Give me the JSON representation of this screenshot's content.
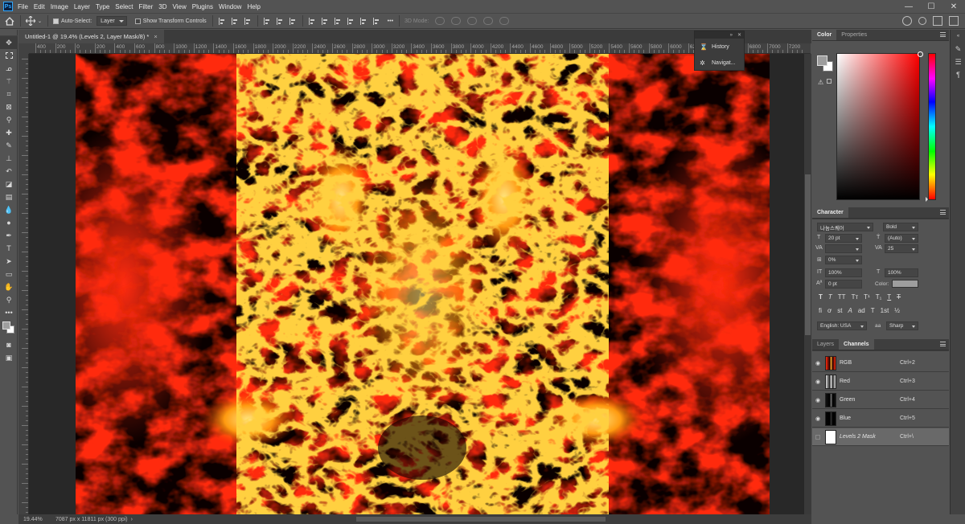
{
  "app": {
    "logo_text": "Ps"
  },
  "menu": [
    "File",
    "Edit",
    "Image",
    "Layer",
    "Type",
    "Select",
    "Filter",
    "3D",
    "View",
    "Plugins",
    "Window",
    "Help"
  ],
  "window_controls": {
    "minimize": "—",
    "maximize": "☐",
    "close": "✕"
  },
  "options_bar": {
    "auto_select_label": "Auto-Select:",
    "auto_select_checked": true,
    "auto_select_target": "Layer",
    "transform_controls_label": "Show Transform Controls",
    "mode_3d_label": "3D Mode:",
    "more_label": "•••"
  },
  "document": {
    "tab_title": "Untitled-1 @ 19.4% (Levels 2, Layer Mask/8) *",
    "tab_close": "×",
    "zoom": "19.44%",
    "doc_info": "7087 px x 11811 px (300 ppi)",
    "status_arrow": "›"
  },
  "ruler": {
    "top_labels": [
      "400",
      "200",
      "0",
      "200",
      "400",
      "600",
      "800",
      "1000",
      "1200",
      "1400",
      "1600",
      "1800",
      "2000",
      "2200",
      "2400",
      "2600",
      "2800",
      "3000",
      "3200",
      "3400",
      "3600",
      "3800",
      "4000",
      "4200",
      "4400",
      "4600",
      "4800",
      "5000",
      "5200",
      "5400",
      "5600",
      "5800",
      "6000",
      "6200",
      "6400",
      "6600",
      "6800",
      "7000",
      "7200"
    ]
  },
  "float_panel": {
    "collapse": "»",
    "close": "✕",
    "items": [
      {
        "label": "History",
        "icon": "history-icon"
      },
      {
        "label": "Navigat...",
        "icon": "navigator-icon"
      }
    ]
  },
  "color_panel": {
    "tabs": [
      "Color",
      "Properties"
    ],
    "foreground": "#9e9e9e",
    "background": "#ffffff",
    "hue": "#ff0000"
  },
  "character_panel": {
    "title": "Character",
    "font_family": "나눔스퀘어",
    "font_style": "Bold",
    "font_size": "20 pt",
    "leading": "(Auto)",
    "kerning": "",
    "tracking": "25",
    "tsume": "0%",
    "vertical_scale": "100%",
    "horizontal_scale": "100%",
    "baseline_shift": "0 pt",
    "color_label": "Color:",
    "type_buttons": [
      "T",
      "T",
      "TT",
      "Tт",
      "T¹",
      "T₁",
      "T",
      "T"
    ],
    "opentype_buttons": [
      "fi",
      "ơ",
      "st",
      "A",
      "ad",
      "T",
      "1st",
      "½"
    ],
    "language": "English: USA",
    "aa_label": "aa",
    "antialias": "Sharp"
  },
  "channels_panel": {
    "tabs": [
      "Layers",
      "Channels"
    ],
    "channels": [
      {
        "name": "RGB",
        "shortcut": "Ctrl+2",
        "visible": true,
        "thumb": "rgb"
      },
      {
        "name": "Red",
        "shortcut": "Ctrl+3",
        "visible": true,
        "thumb": "red"
      },
      {
        "name": "Green",
        "shortcut": "Ctrl+4",
        "visible": true,
        "thumb": "green"
      },
      {
        "name": "Blue",
        "shortcut": "Ctrl+5",
        "visible": true,
        "thumb": "blue"
      },
      {
        "name": "Levels 2 Mask",
        "shortcut": "Ctrl+\\",
        "visible": false,
        "thumb": "mask"
      }
    ]
  }
}
